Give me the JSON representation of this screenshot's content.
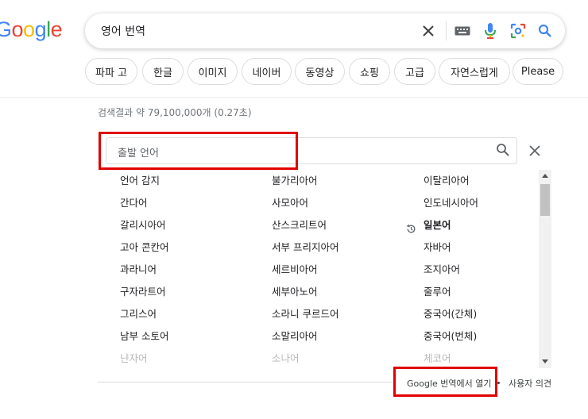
{
  "logo": {
    "text": "Google",
    "letters": [
      "G",
      "o",
      "o",
      "g",
      "l",
      "e"
    ],
    "colors": [
      "#4285f4",
      "#ea4335",
      "#fbbc05",
      "#4285f4",
      "#34a853",
      "#ea4335"
    ]
  },
  "search": {
    "query": "영어 번역",
    "icons": [
      "close-icon",
      "keyboard-icon",
      "microphone-icon",
      "lens-icon",
      "search-icon"
    ]
  },
  "chips": [
    "파파 고",
    "한글",
    "이미지",
    "네이버",
    "동영상",
    "쇼핑",
    "고급",
    "자연스럽게",
    "Please"
  ],
  "stats": "검색결과 약 79,100,000개 (0.27초)",
  "translate": {
    "source_search_placeholder": "출발 언어",
    "columns": [
      [
        "언어 감지",
        "간다어",
        "갈리시아어",
        "고아 콘칸어",
        "과라니어",
        "구자라트어",
        "그리스어",
        "남부 소토어",
        "냔자어"
      ],
      [
        "불가리아어",
        "사모아어",
        "산스크리트어",
        "서부 프리지아어",
        "세르비아어",
        "세부아노어",
        "소라니 쿠르드어",
        "소말리아어",
        "소나어"
      ],
      [
        "이탈리아어",
        "인도네시아어",
        "일본어",
        "자바어",
        "조지아어",
        "줄루어",
        "중국어(간체)",
        "중국어(번체)",
        "체코어"
      ]
    ],
    "recent_language": "일본어",
    "open_in_translate": "Google 번역에서 열기",
    "feedback": "사용자 의견"
  },
  "colors": {
    "highlight": "#e00000",
    "google_blue": "#4285f4"
  }
}
